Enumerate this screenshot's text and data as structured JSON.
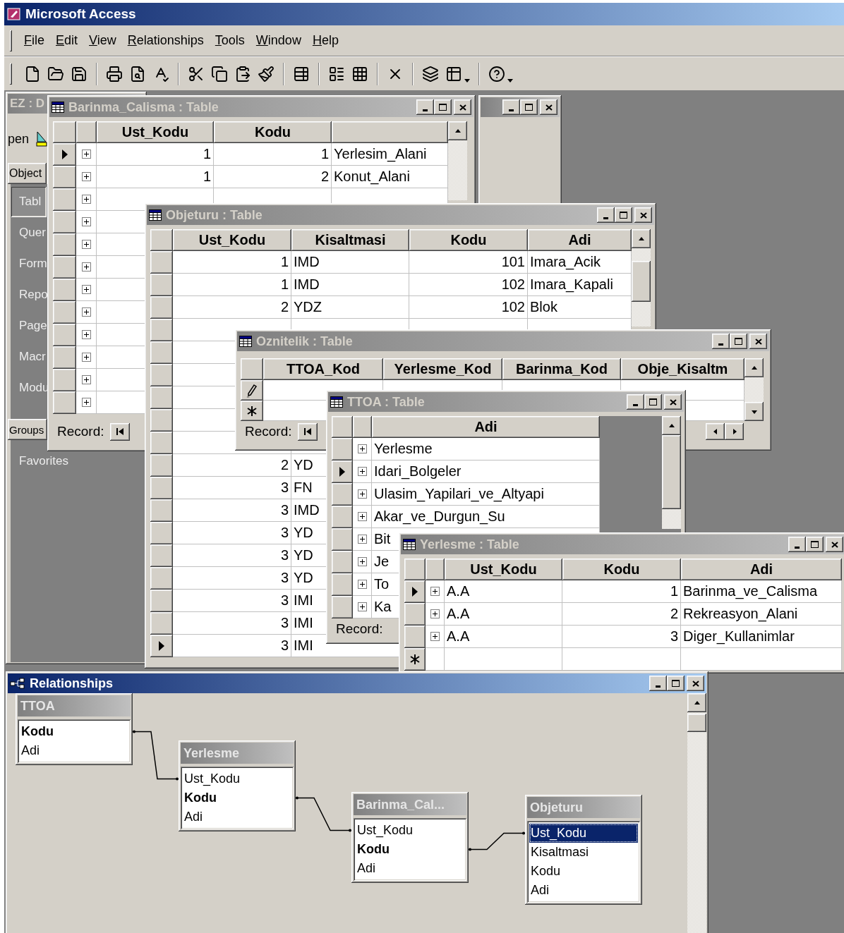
{
  "app": {
    "title": "Microsoft Access"
  },
  "menu": [
    "File",
    "Edit",
    "View",
    "Relationships",
    "Tools",
    "Window",
    "Help"
  ],
  "database_window": {
    "title": "EZ : D",
    "active": false,
    "open_label": "pen",
    "objects_label": "Object",
    "objects": [
      {
        "label": "Tabl",
        "selected": true
      },
      {
        "label": "Quer",
        "selected": false
      },
      {
        "label": "Form",
        "selected": false
      },
      {
        "label": "Repo",
        "selected": false
      },
      {
        "label": "Page",
        "selected": false
      },
      {
        "label": "Macr",
        "selected": false
      },
      {
        "label": "Modu",
        "selected": false
      }
    ],
    "groups_label": "Groups",
    "favorites_label": "Favorites"
  },
  "barinma_calisma": {
    "title": "Barinma_Calisma : Table",
    "active": false,
    "columns": [
      "Ust_Kodu",
      "Kodu"
    ],
    "rows": [
      {
        "ust_kodu": "1",
        "kodu": "1",
        "column_3": "Yerlesim_Alani",
        "selected": true
      },
      {
        "ust_kodu": "1",
        "kodu": "2",
        "column_3": "Konut_Alani",
        "selected": false
      }
    ],
    "record_label": "Record:"
  },
  "objeturu": {
    "title": "Objeturu : Table",
    "active": false,
    "columns": [
      "Ust_Kodu",
      "Kisaltmasi",
      "Kodu",
      "Adi"
    ],
    "rows_top": [
      {
        "ust_kodu": "1",
        "kisaltmasi": "IMD",
        "kodu": "101",
        "adi": "Imara_Acik",
        "selected": false
      },
      {
        "ust_kodu": "1",
        "kisaltmasi": "IMD",
        "kodu": "102",
        "adi": "Imara_Kapali",
        "selected": false
      },
      {
        "ust_kodu": "2",
        "kisaltmasi": "YDZ",
        "kodu": "102",
        "adi": "Blok",
        "selected": false
      }
    ],
    "rows_bottom": [
      {
        "ust_kodu": "2",
        "kisaltmasi": "YD",
        "selected": false
      },
      {
        "ust_kodu": "3",
        "kisaltmasi": "FN",
        "selected": false
      },
      {
        "ust_kodu": "3",
        "kisaltmasi": "IMD",
        "selected": false
      },
      {
        "ust_kodu": "3",
        "kisaltmasi": "YD",
        "selected": false
      },
      {
        "ust_kodu": "3",
        "kisaltmasi": "YD",
        "selected": false
      },
      {
        "ust_kodu": "3",
        "kisaltmasi": "YD",
        "selected": false
      },
      {
        "ust_kodu": "3",
        "kisaltmasi": "IMI",
        "selected": false
      },
      {
        "ust_kodu": "3",
        "kisaltmasi": "IMI",
        "selected": false
      },
      {
        "ust_kodu": "3",
        "kisaltmasi": "IMI",
        "selected": true
      }
    ]
  },
  "oznitelik": {
    "title": "Oznitelik : Table",
    "active": false,
    "columns": [
      "TTOA_Kod",
      "Yerlesme_Kod",
      "Barinma_Kod",
      "Obje_Kisaltm"
    ],
    "rows": [
      {
        "kind": "editing"
      },
      {
        "kind": "new"
      }
    ],
    "record_label": "Record:"
  },
  "ttoa": {
    "title": "TTOA : Table",
    "active": false,
    "columns": [
      "Adi"
    ],
    "rows": [
      {
        "adi": "Yerlesme",
        "selected": false
      },
      {
        "adi": "Idari_Bolgeler",
        "selected": true
      },
      {
        "adi": "Ulasim_Yapilari_ve_Altyapi",
        "selected": false
      },
      {
        "adi": "Akar_ve_Durgun_Su",
        "selected": false
      },
      {
        "adi": "Bit",
        "selected": false
      },
      {
        "adi": "Je",
        "selected": false
      },
      {
        "adi": "To",
        "selected": false
      },
      {
        "adi": "Ka",
        "selected": false
      }
    ],
    "record_label": "Record:"
  },
  "yerlesme": {
    "title": "Yerlesme : Table",
    "active": false,
    "columns": [
      "Ust_Kodu",
      "Kodu",
      "Adi"
    ],
    "rows": [
      {
        "kind": "record",
        "ust_kodu": "A.A",
        "kodu": "1",
        "adi": "Barinma_ve_Calisma",
        "selected": true
      },
      {
        "kind": "record",
        "ust_kodu": "A.A",
        "kodu": "2",
        "adi": "Rekreasyon_Alani",
        "selected": false
      },
      {
        "kind": "record",
        "ust_kodu": "A.A",
        "kodu": "3",
        "adi": "Diger_Kullanimlar",
        "selected": false
      },
      {
        "kind": "new"
      }
    ]
  },
  "relationships": {
    "title": "Relationships",
    "active": true,
    "tables": [
      {
        "title": "TTOA",
        "fields": [
          {
            "name": "Kodu",
            "key": true,
            "selected": false
          },
          {
            "name": "Adi",
            "key": false,
            "selected": false
          }
        ]
      },
      {
        "title": "Yerlesme",
        "fields": [
          {
            "name": "Ust_Kodu",
            "key": false,
            "foreign_key": true,
            "selected": false
          },
          {
            "name": "Kodu",
            "key": true,
            "selected": false
          },
          {
            "name": "Adi",
            "key": false,
            "selected": false
          }
        ]
      },
      {
        "title": "Barinma_Cal...",
        "fields": [
          {
            "name": "Ust_Kodu",
            "key": false,
            "foreign_key": true,
            "selected": false
          },
          {
            "name": "Kodu",
            "key": true,
            "selected": false
          },
          {
            "name": "Adi",
            "key": false,
            "selected": false
          }
        ]
      },
      {
        "title": "Objeturu",
        "fields": [
          {
            "name": "Ust_Kodu",
            "key": false,
            "foreign_key": true,
            "selected": true
          },
          {
            "name": "Kisaltmasi",
            "key": false,
            "selected": false
          },
          {
            "name": "Kodu",
            "key": false,
            "selected": false
          },
          {
            "name": "Adi",
            "key": false,
            "selected": false
          }
        ]
      }
    ]
  }
}
